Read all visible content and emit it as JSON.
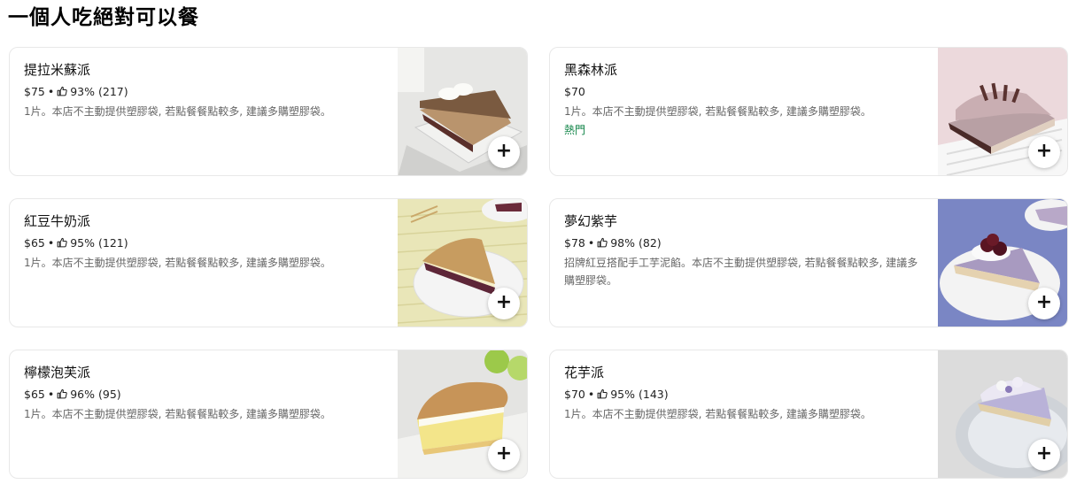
{
  "section": {
    "title": "一個人吃絕對可以餐"
  },
  "items": [
    {
      "name": "提拉米蘇派",
      "price": "$75",
      "rating": "93% (217)",
      "description": "1片。本店不主動提供塑膠袋, 若點餐餐點較多, 建議多購塑膠袋。",
      "badge": "",
      "image_icon": "tiramisu-pie-image"
    },
    {
      "name": "黑森林派",
      "price": "$70",
      "rating": "",
      "description": "1片。本店不主動提供塑膠袋, 若點餐餐點較多, 建議多購塑膠袋。",
      "badge": "熱門",
      "image_icon": "black-forest-pie-image"
    },
    {
      "name": "紅豆牛奶派",
      "price": "$65",
      "rating": "95% (121)",
      "description": "1片。本店不主動提供塑膠袋, 若點餐餐點較多, 建議多購塑膠袋。",
      "badge": "",
      "image_icon": "red-bean-milk-pie-image"
    },
    {
      "name": "夢幻紫芋",
      "price": "$78",
      "rating": "98% (82)",
      "description": "招牌紅豆搭配手工芋泥餡。本店不主動提供塑膠袋, 若點餐餐點較多, 建議多購塑膠袋。",
      "badge": "",
      "image_icon": "purple-taro-pie-image"
    },
    {
      "name": "檸檬泡芙派",
      "price": "$65",
      "rating": "96% (95)",
      "description": "1片。本店不主動提供塑膠袋, 若點餐餐點較多, 建議多購塑膠袋。",
      "badge": "",
      "image_icon": "lemon-puff-pie-image"
    },
    {
      "name": "花芋派",
      "price": "$70",
      "rating": "95% (143)",
      "description": "1片。本店不主動提供塑膠袋, 若點餐餐點較多, 建議多購塑膠袋。",
      "badge": "",
      "image_icon": "taro-flower-pie-image"
    }
  ],
  "labels": {
    "add_symbol": "+",
    "separator": "•"
  },
  "colors": {
    "popular_badge": "#0e8345",
    "description_text": "#666666",
    "card_border": "#e8e8e8"
  }
}
